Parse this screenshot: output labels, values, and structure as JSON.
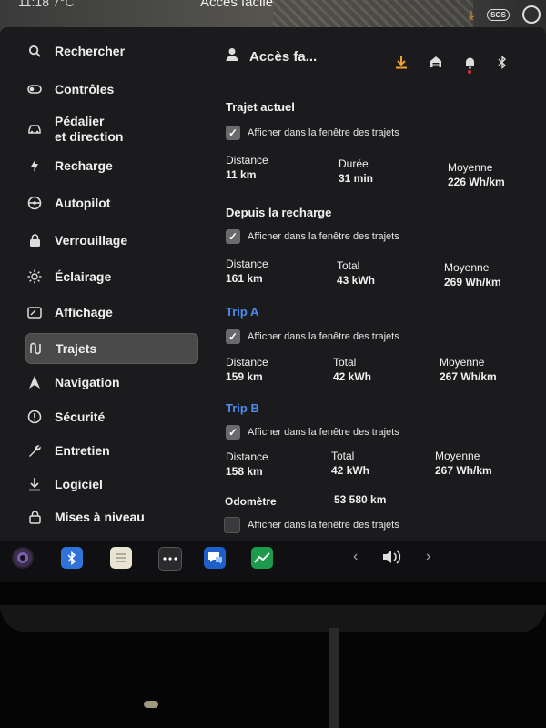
{
  "status_bar": {
    "title": "Accès facile",
    "left_text": "11:18  7°C",
    "sos_label": "SOS"
  },
  "sidebar": {
    "items": [
      {
        "label": "Rechercher",
        "icon": "search-icon"
      },
      {
        "label": "Contrôles",
        "icon": "toggle-icon"
      },
      {
        "label": "Pédalier\net direction",
        "icon": "car-icon"
      },
      {
        "label": "Recharge",
        "icon": "bolt-icon"
      },
      {
        "label": "Autopilot",
        "icon": "steering-wheel-icon"
      },
      {
        "label": "Verrouillage",
        "icon": "lock-icon"
      },
      {
        "label": "Éclairage",
        "icon": "sun-icon"
      },
      {
        "label": "Affichage",
        "icon": "display-icon"
      },
      {
        "label": "Trajets",
        "icon": "trips-icon"
      },
      {
        "label": "Navigation",
        "icon": "navigation-arrow-icon"
      },
      {
        "label": "Sécurité",
        "icon": "alert-circle-icon"
      },
      {
        "label": "Entretien",
        "icon": "wrench-icon"
      },
      {
        "label": "Logiciel",
        "icon": "download-icon"
      },
      {
        "label": "Mises à niveau",
        "icon": "lock-open-icon"
      }
    ],
    "active_index": 8
  },
  "header": {
    "profile_label": "Accès fa...",
    "icons": [
      "download-icon",
      "garage-icon",
      "bell-icon",
      "bluetooth-icon"
    ],
    "accent": "#f0a030"
  },
  "trips": {
    "checkbox_label": "Afficher dans la fenêtre des trajets",
    "current": {
      "title": "Trajet actuel",
      "checked": true,
      "stats": [
        {
          "label": "Distance",
          "value": "11 km"
        },
        {
          "label": "Durée",
          "value": "31 min"
        },
        {
          "label": "Moyenne",
          "value": "226 Wh/km"
        }
      ]
    },
    "since_charge": {
      "title": "Depuis la recharge",
      "checked": true,
      "stats": [
        {
          "label": "Distance",
          "value": "161 km"
        },
        {
          "label": "Total",
          "value": "43 kWh"
        },
        {
          "label": "Moyenne",
          "value": "269 Wh/km"
        }
      ]
    },
    "trip_a": {
      "title": "Trip A",
      "checked": true,
      "stats": [
        {
          "label": "Distance",
          "value": "159 km"
        },
        {
          "label": "Total",
          "value": "42 kWh"
        },
        {
          "label": "Moyenne",
          "value": "267 Wh/km"
        }
      ]
    },
    "trip_b": {
      "title": "Trip B",
      "checked": true,
      "stats": [
        {
          "label": "Distance",
          "value": "158 km"
        },
        {
          "label": "Total",
          "value": "42 kWh"
        },
        {
          "label": "Moyenne",
          "value": "267 Wh/km"
        }
      ]
    },
    "odometer": {
      "label": "Odomètre",
      "value": "53 580 km",
      "checked": false
    },
    "title_blue": "#4d8cf0"
  },
  "taskbar": {
    "apps": [
      "camera-icon",
      "bluetooth-icon",
      "notepad-icon",
      "more-icon",
      "messages-icon",
      "energy-chart-icon"
    ],
    "prev": "‹",
    "next": "›",
    "volume_icon": "volume-icon"
  }
}
